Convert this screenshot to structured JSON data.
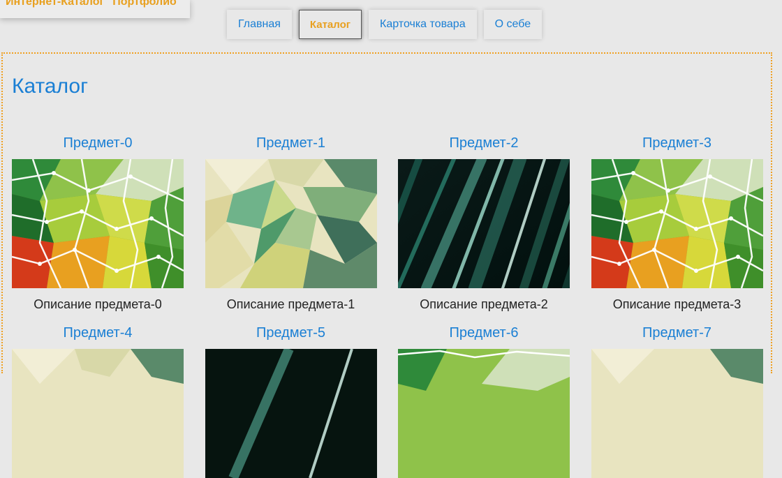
{
  "logo": {
    "text": "Интернет-Каталог \"Портфолио\""
  },
  "nav": {
    "items": [
      {
        "label": "Главная"
      },
      {
        "label": "Каталог"
      },
      {
        "label": "Карточка товара"
      },
      {
        "label": "О себе"
      }
    ]
  },
  "page": {
    "title": "Каталог"
  },
  "catalog": {
    "items": [
      {
        "title": "Предмет-0",
        "description": "Описание предмета-0",
        "image": "green-geometric-web"
      },
      {
        "title": "Предмет-1",
        "description": "Описание предмета-1",
        "image": "yellow-green-polygons"
      },
      {
        "title": "Предмет-2",
        "description": "Описание предмета-2",
        "image": "teal-light-streaks"
      },
      {
        "title": "Предмет-3",
        "description": "Описание предмета-3",
        "image": "green-geometric-web"
      },
      {
        "title": "Предмет-4",
        "description": "",
        "image": "yellow-green-polygons"
      },
      {
        "title": "Предмет-5",
        "description": "",
        "image": "teal-light-streaks"
      },
      {
        "title": "Предмет-6",
        "description": "",
        "image": "green-geometric-web"
      },
      {
        "title": "Предмет-7",
        "description": "",
        "image": "yellow-green-polygons"
      }
    ]
  },
  "colors": {
    "accent": "#1a7fd4",
    "highlight": "#e8a020",
    "background": "#e8e8e8"
  }
}
